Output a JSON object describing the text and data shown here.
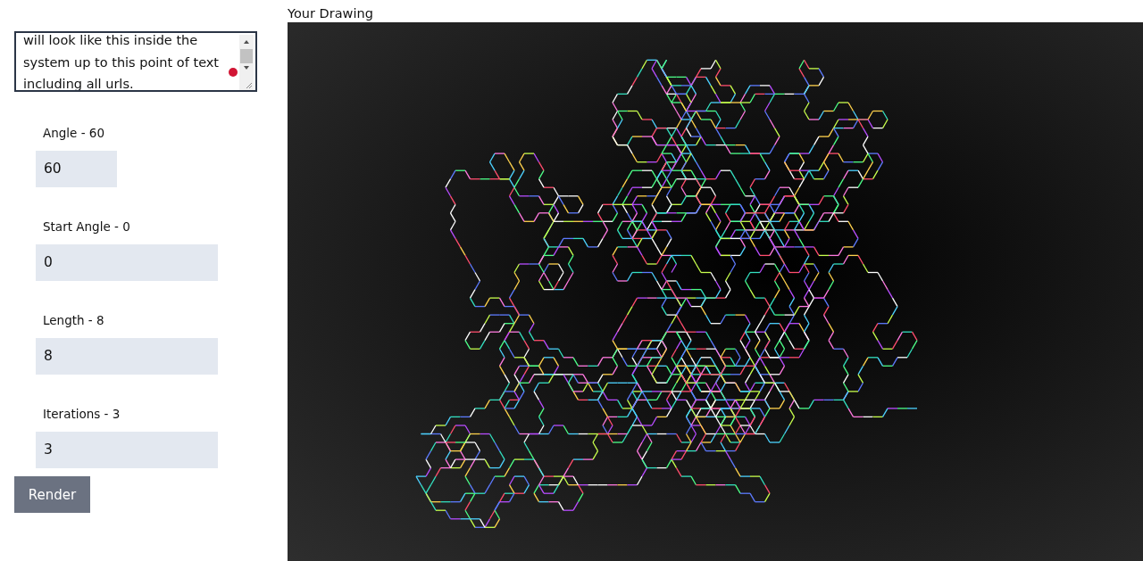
{
  "text_input": {
    "lines": [
      "will look like this inside the",
      "system up to this point of text",
      "including all urls."
    ]
  },
  "fields": [
    {
      "label": "Angle - 60",
      "value": "60"
    },
    {
      "label": "Start Angle - 0",
      "value": "0"
    },
    {
      "label": "Length - 8",
      "value": "8"
    },
    {
      "label": "Iterations - 3",
      "value": "3"
    }
  ],
  "render_button": "Render",
  "drawing": {
    "title": "Your Drawing"
  }
}
